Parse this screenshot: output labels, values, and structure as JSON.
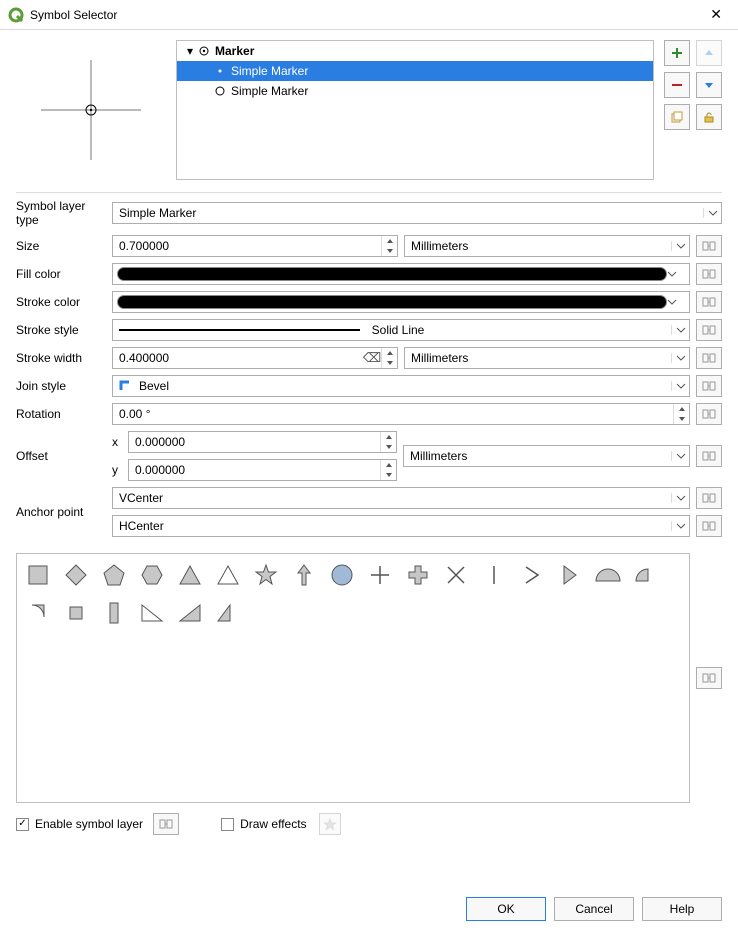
{
  "window": {
    "title": "Symbol Selector"
  },
  "layer_tree": {
    "root": {
      "label": "Marker",
      "expanded": true
    },
    "items": [
      {
        "label": "Simple Marker",
        "selected": true
      },
      {
        "label": "Simple Marker",
        "selected": false
      }
    ]
  },
  "symbol_layer_type": {
    "label": "Symbol layer type",
    "value": "Simple Marker"
  },
  "fields": {
    "size": {
      "label": "Size",
      "value": "0.700000",
      "unit": "Millimeters"
    },
    "fill_color": {
      "label": "Fill color",
      "value": "#000000"
    },
    "stroke_color": {
      "label": "Stroke color",
      "value": "#000000"
    },
    "stroke_style": {
      "label": "Stroke style",
      "value": "Solid Line"
    },
    "stroke_width": {
      "label": "Stroke width",
      "value": "0.400000",
      "unit": "Millimeters"
    },
    "join_style": {
      "label": "Join style",
      "value": "Bevel"
    },
    "rotation": {
      "label": "Rotation",
      "value": "0.00 °"
    },
    "offset": {
      "label": "Offset",
      "x_label": "x",
      "x": "0.000000",
      "y_label": "y",
      "y": "0.000000",
      "unit": "Millimeters"
    },
    "anchor_point": {
      "label": "Anchor point",
      "v": "VCenter",
      "h": "HCenter"
    }
  },
  "bottom": {
    "enable_symbol_layer": {
      "label": "Enable symbol layer",
      "checked": true
    },
    "draw_effects": {
      "label": "Draw effects",
      "checked": false
    }
  },
  "buttons": {
    "ok": "OK",
    "cancel": "Cancel",
    "help": "Help"
  },
  "side_buttons": {
    "add": "add-layer",
    "remove": "remove-layer",
    "up": "move-up",
    "down": "move-down",
    "copy": "duplicate-layer",
    "lock": "lock-layer"
  }
}
